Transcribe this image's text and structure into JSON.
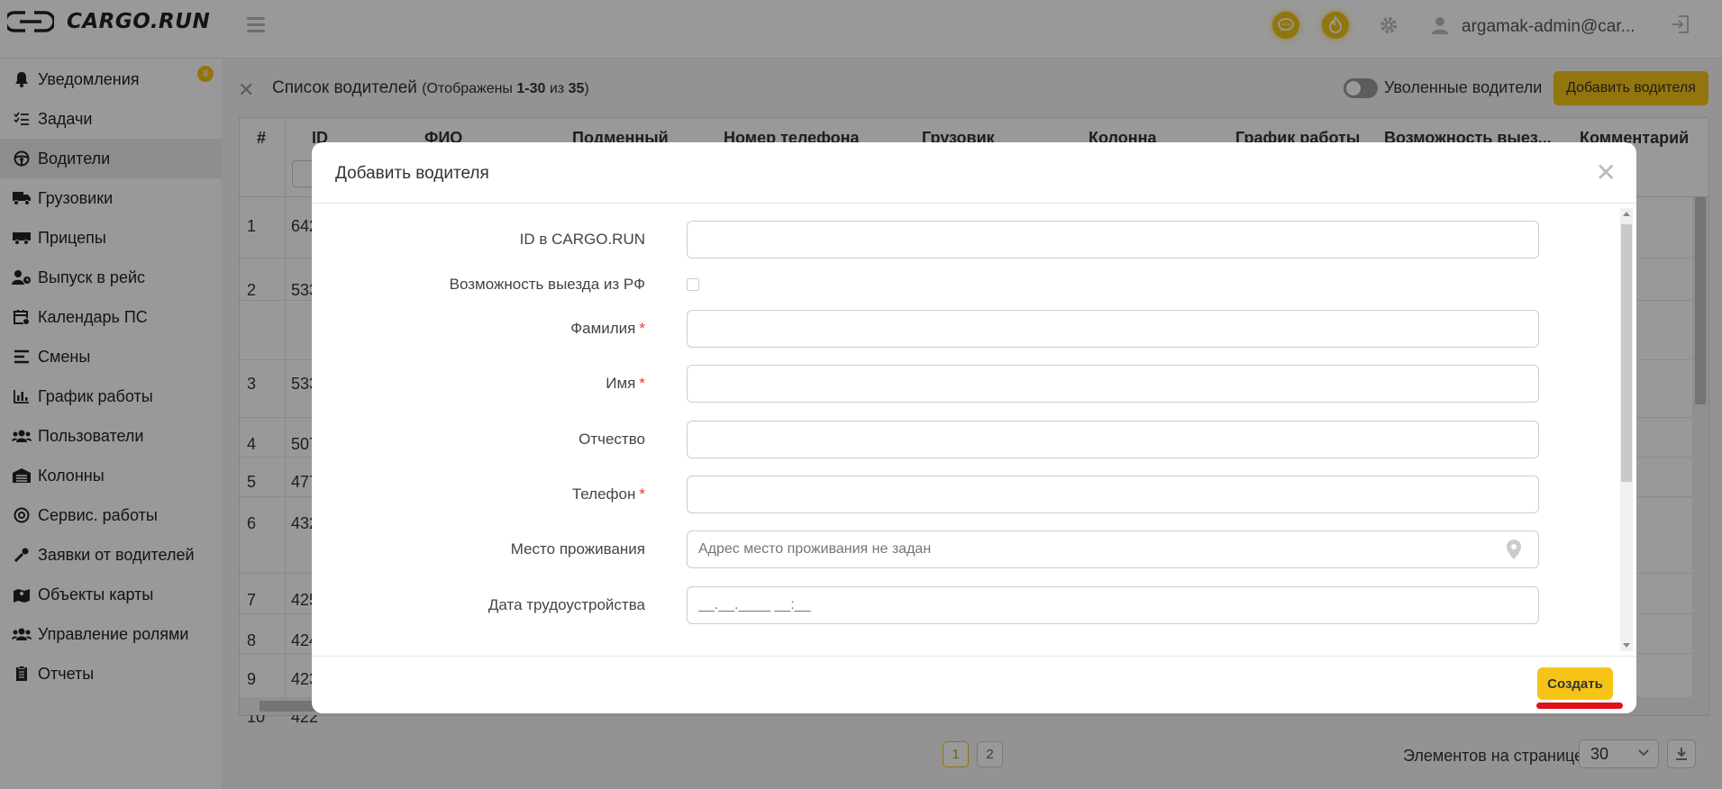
{
  "header": {
    "logo_text": "CARGO.RUN",
    "user_name": "argamak-admin@car..."
  },
  "sidebar": {
    "notifications_badge": "8",
    "items": [
      {
        "label": "Уведомления",
        "icon": "bell-icon"
      },
      {
        "label": "Задачи",
        "icon": "checklist-icon"
      },
      {
        "label": "Водители",
        "icon": "steering-wheel-icon"
      },
      {
        "label": "Грузовики",
        "icon": "truck-icon"
      },
      {
        "label": "Прицепы",
        "icon": "trailer-icon"
      },
      {
        "label": "Выпуск в рейс",
        "icon": "user-clock-icon"
      },
      {
        "label": "Календарь ПС",
        "icon": "calendar-icon"
      },
      {
        "label": "Смены",
        "icon": "shifts-icon"
      },
      {
        "label": "График работы",
        "icon": "bar-chart-icon"
      },
      {
        "label": "Пользователи",
        "icon": "users-icon"
      },
      {
        "label": "Колонны",
        "icon": "garage-icon"
      },
      {
        "label": "Сервис. работы",
        "icon": "service-icon"
      },
      {
        "label": "Заявки от водителей",
        "icon": "wrench-icon"
      },
      {
        "label": "Объекты карты",
        "icon": "map-icon"
      },
      {
        "label": "Управление ролями",
        "icon": "roles-icon"
      },
      {
        "label": "Отчеты",
        "icon": "report-icon"
      }
    ],
    "active_index": 2
  },
  "list": {
    "title": "Список водителей",
    "subtitle_prefix": "(Отображены ",
    "range": "1-30",
    "of": " из ",
    "total": "35",
    "subtitle_suffix": ")",
    "fired_label": "Уволенные водители",
    "add_button": "Добавить водителя",
    "columns": [
      "#",
      "ID",
      "ФИО",
      "Подменный",
      "Номер телефона",
      "Грузовик",
      "Колонна",
      "График работы",
      "Возможность выез...",
      "Комментарий"
    ],
    "rows": [
      {
        "num": "1",
        "id": "642"
      },
      {
        "num": "2",
        "id": "533"
      },
      {
        "num": "3",
        "id": "533"
      },
      {
        "num": "4",
        "id": "507"
      },
      {
        "num": "5",
        "id": "477"
      },
      {
        "num": "6",
        "id": "432"
      },
      {
        "num": "7",
        "id": "425"
      },
      {
        "num": "8",
        "id": "424"
      },
      {
        "num": "9",
        "id": "423"
      },
      {
        "num": "10",
        "id": "422"
      }
    ],
    "pages": [
      "1",
      "2"
    ],
    "per_page_label": "Элементов на странице",
    "per_page_value": "30"
  },
  "modal": {
    "title": "Добавить водителя",
    "fields": [
      {
        "label": "ID в CARGO.RUN",
        "required": false,
        "type": "text",
        "placeholder": ""
      },
      {
        "label": "Возможность выезда из РФ",
        "required": false,
        "type": "checkbox",
        "placeholder": ""
      },
      {
        "label": "Фамилия",
        "required": true,
        "type": "text",
        "placeholder": ""
      },
      {
        "label": "Имя",
        "required": true,
        "type": "text",
        "placeholder": ""
      },
      {
        "label": "Отчество",
        "required": false,
        "type": "text",
        "placeholder": ""
      },
      {
        "label": "Телефон",
        "required": true,
        "type": "text",
        "placeholder": ""
      },
      {
        "label": "Место проживания",
        "required": false,
        "type": "address",
        "placeholder": "Адрес место проживания не задан"
      },
      {
        "label": "Дата трудоустройства",
        "required": false,
        "type": "date",
        "placeholder": "__.__.____ __:__"
      }
    ],
    "required_mark": "*",
    "create_button": "Создать"
  },
  "colors": {
    "accent": "#f6c417",
    "required": "#e03a3a",
    "highlight": "#e0101a"
  }
}
